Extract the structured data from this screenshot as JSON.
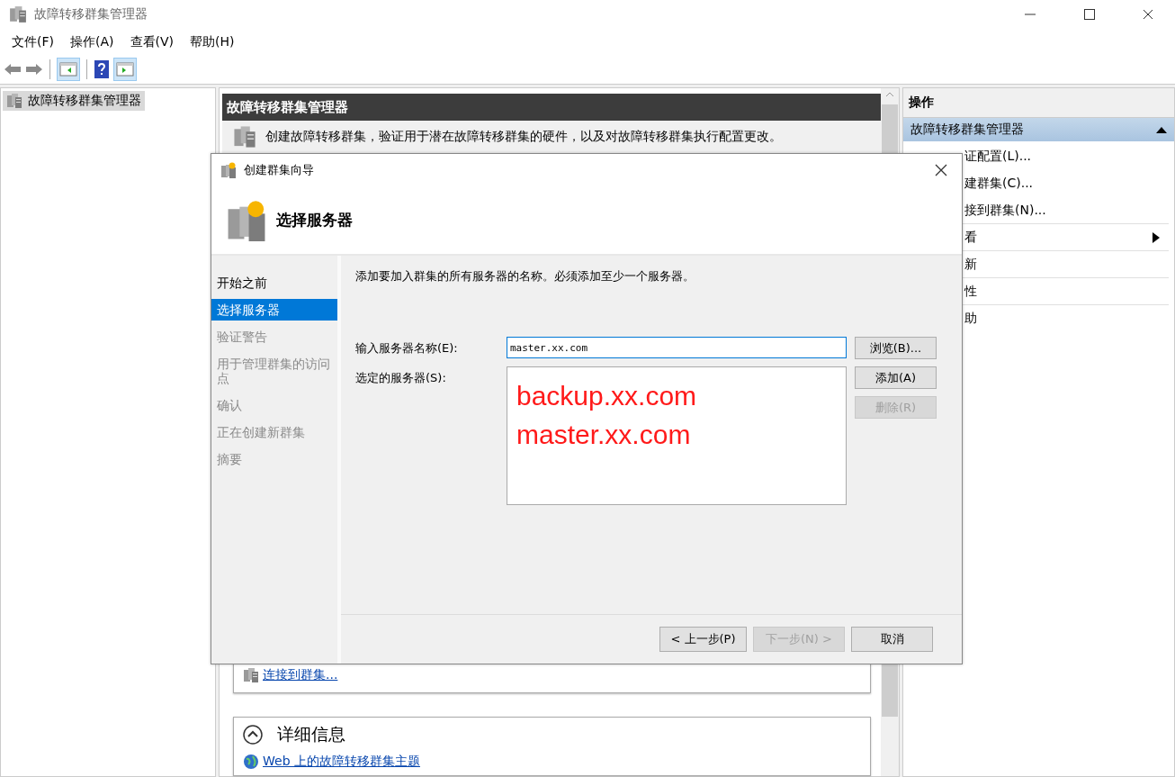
{
  "window": {
    "title": "故障转移群集管理器"
  },
  "menu": [
    "文件(F)",
    "操作(A)",
    "查看(V)",
    "帮助(H)"
  ],
  "tree": {
    "items": [
      {
        "label": "故障转移群集管理器",
        "selected": true
      }
    ]
  },
  "center": {
    "header": "故障转移群集管理器",
    "description": "创建故障转移群集，验证用于潜在故障转移群集的硬件，以及对故障转移群集执行配置更改。",
    "connect_link": "连接到群集...",
    "details": {
      "title": "详细信息",
      "expanded": true,
      "link": "Web 上的故障转移群集主题"
    }
  },
  "actions": {
    "title": "操作",
    "section": "故障转移群集管理器",
    "items": [
      {
        "label": "证配置(L)...",
        "submenu": false
      },
      {
        "label": "建群集(C)...",
        "submenu": false
      },
      {
        "label": "接到群集(N)...",
        "submenu": false
      },
      {
        "label": "看",
        "submenu": true
      },
      {
        "label": "新",
        "submenu": false
      },
      {
        "label": "性",
        "submenu": false
      },
      {
        "label": "助",
        "submenu": false
      }
    ]
  },
  "dialog": {
    "title": "创建群集向导",
    "heading": "选择服务器",
    "steps": [
      {
        "label": "开始之前",
        "selected": false,
        "disabled": false
      },
      {
        "label": "选择服务器",
        "selected": true,
        "disabled": false
      },
      {
        "label": "验证警告",
        "selected": false,
        "disabled": true
      },
      {
        "label": "用于管理群集的访问点",
        "selected": false,
        "disabled": true
      },
      {
        "label": "确认",
        "selected": false,
        "disabled": true
      },
      {
        "label": "正在创建新群集",
        "selected": false,
        "disabled": true
      },
      {
        "label": "摘要",
        "selected": false,
        "disabled": true
      }
    ],
    "instruction": "添加要加入群集的所有服务器的名称。必须添加至少一个服务器。",
    "server_name": {
      "label": "输入服务器名称(E):",
      "value": "master.xx.com"
    },
    "selected_servers": {
      "label": "选定的服务器(S):",
      "items": [
        "backup.xx.com",
        "master.xx.com"
      ]
    },
    "side_buttons": [
      {
        "label": "浏览(B)...",
        "disabled": false
      },
      {
        "label": "添加(A)",
        "disabled": false
      },
      {
        "label": "删除(R)",
        "disabled": true
      }
    ],
    "footer_buttons": [
      {
        "label": "< 上一步(P)",
        "disabled": false
      },
      {
        "label": "下一步(N) >",
        "disabled": true
      },
      {
        "label": "取消",
        "disabled": false
      }
    ]
  }
}
